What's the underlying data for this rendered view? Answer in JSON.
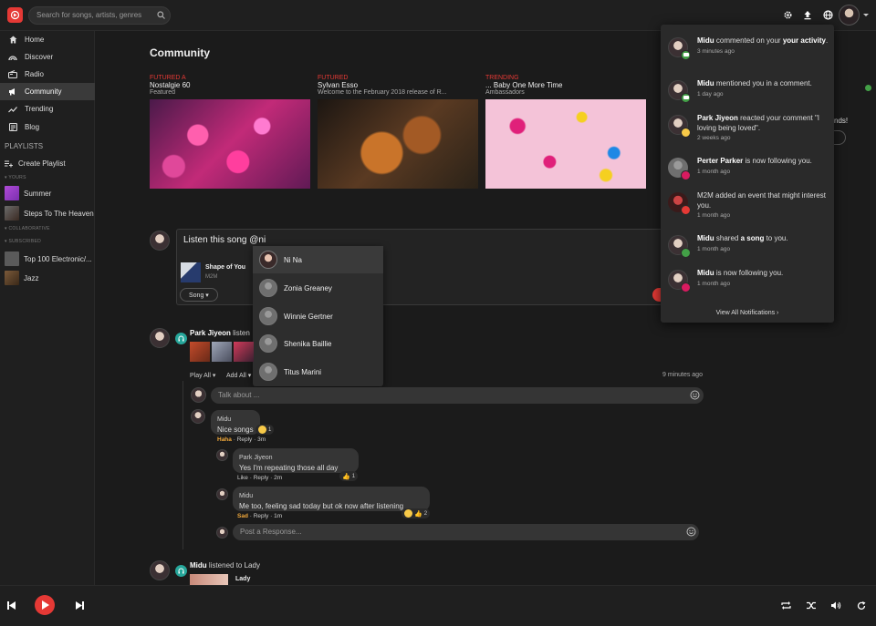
{
  "header": {
    "search_placeholder": "Search for songs, artists, genres"
  },
  "sidebar": {
    "nav": [
      {
        "label": "Home",
        "icon": "home-icon"
      },
      {
        "label": "Discover",
        "icon": "discover-icon"
      },
      {
        "label": "Radio",
        "icon": "radio-icon"
      },
      {
        "label": "Community",
        "icon": "community-icon"
      },
      {
        "label": "Trending",
        "icon": "trending-icon"
      },
      {
        "label": "Blog",
        "icon": "blog-icon"
      }
    ],
    "playlists_heading": "PLAYLISTS",
    "create_playlist": "Create Playlist",
    "yours_label": "YOURS",
    "yours": [
      "Summer",
      "Steps To The Heaven"
    ],
    "collaborative_label": "COLLABORATIVE",
    "subscribed_label": "SUBSCRIBED",
    "subscribed": [
      "Top 100 Electronic/...",
      "Jazz"
    ]
  },
  "main": {
    "title": "Community",
    "cards": [
      {
        "tag": "FUTURED A",
        "title": "Nostalgie 60",
        "sub": "Featured"
      },
      {
        "tag": "FUTURED",
        "title": "Sylvan Esso",
        "sub": "Welcome to the February 2018 release of R..."
      },
      {
        "tag": "TRENDING",
        "title": "... Baby One More Time",
        "sub": "Ambassadors"
      }
    ],
    "composer": {
      "text": "Listen this song @ni",
      "song_title": "Shape of You",
      "song_sub": "M2M",
      "song_button": "Song"
    },
    "mentions": [
      "Ni Na",
      "Zonia Greaney",
      "Winnie Gertner",
      "Shenika Baillie",
      "Titus Marini"
    ],
    "post1": {
      "user": "Park Jiyeon",
      "action": "listen",
      "play_all": "Play All",
      "add_all": "Add All",
      "time": "9 minutes ago",
      "talk_placeholder": "Talk about ..."
    },
    "comments": [
      {
        "name": "Midu",
        "text": "Nice songs",
        "react": "Haha",
        "reply": "Reply",
        "time": "3m",
        "count": "1"
      },
      {
        "name": "Park Jiyeon",
        "text": "Yes I'm repeating those all day",
        "react": "Like",
        "reply": "Reply",
        "time": "2m",
        "count": "1"
      },
      {
        "name": "Midu",
        "text": "Me too, feeling sad today but ok now after listening",
        "react": "Sad",
        "reply": "Reply",
        "time": "1m",
        "count": "2"
      }
    ],
    "response_placeholder": "Post a Response...",
    "post2": {
      "user": "Midu",
      "action": "listened to",
      "target": "Lady",
      "album": "Lady"
    }
  },
  "notifications": [
    {
      "pre": "",
      "name": "Midu",
      "mid": " commented on your ",
      "bold2": "your activity",
      "post": ".",
      "time": "3 minutes ago",
      "badge": "#43a047"
    },
    {
      "pre": "",
      "name": "Midu",
      "mid": " mentioned you in a comment.",
      "bold2": "",
      "post": "",
      "time": "1 day ago",
      "badge": "#43a047"
    },
    {
      "pre": "",
      "name": "Park Jiyeon",
      "mid": " reacted your comment \"I loving being loved\".",
      "bold2": "",
      "post": "",
      "time": "2 weeks ago",
      "badge": "#f7c948"
    },
    {
      "pre": "",
      "name": "Perter Parker",
      "mid": " is now following you.",
      "bold2": "",
      "post": "",
      "time": "1 month ago",
      "badge": "#d81b60"
    },
    {
      "pre": "",
      "name": "",
      "mid": "M2M added an event that might interest you.",
      "bold2": "",
      "post": "",
      "time": "1 month ago",
      "badge": "#e53935"
    },
    {
      "pre": "",
      "name": "Midu",
      "mid": " shared ",
      "bold2": "a song",
      "post": " to you.",
      "time": "1 month ago",
      "badge": "#43a047"
    },
    {
      "pre": "",
      "name": "Midu",
      "mid": " is now following you.",
      "bold2": "",
      "post": "",
      "time": "1 month ago",
      "badge": "#d81b60"
    }
  ],
  "view_all": "View All Notifications",
  "right_panel_text": "nds!",
  "colors": {
    "accent": "#e53935",
    "teal": "#26a69a",
    "online": "#43a047"
  }
}
